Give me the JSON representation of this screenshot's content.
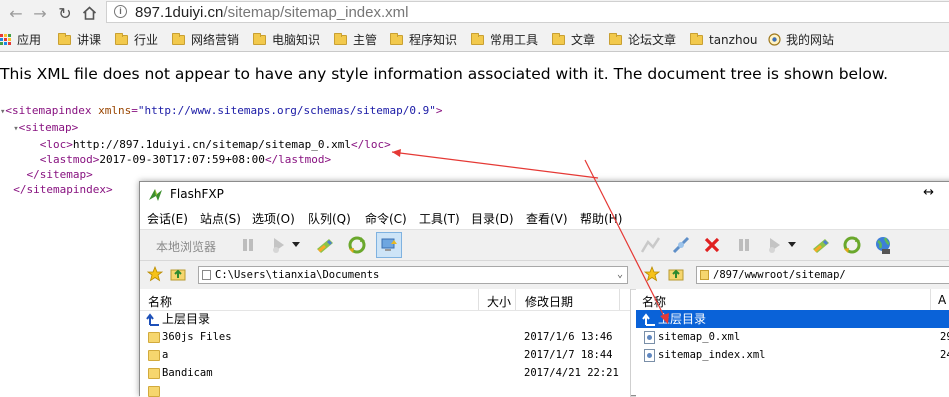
{
  "browser": {
    "url_host": "897.1duiyi.cn",
    "url_path": "/sitemap/sitemap_index.xml",
    "bookmarks": [
      {
        "label": "应用",
        "icon": "apps-icon"
      },
      {
        "label": "讲课",
        "icon": "folder-icon"
      },
      {
        "label": "行业",
        "icon": "folder-icon"
      },
      {
        "label": "网络营销",
        "icon": "folder-icon"
      },
      {
        "label": "电脑知识",
        "icon": "folder-icon"
      },
      {
        "label": "主管",
        "icon": "folder-icon"
      },
      {
        "label": "程序知识",
        "icon": "folder-icon"
      },
      {
        "label": "常用工具",
        "icon": "folder-icon"
      },
      {
        "label": "文章",
        "icon": "folder-icon"
      },
      {
        "label": "论坛文章",
        "icon": "folder-icon"
      },
      {
        "label": "tanzhou",
        "icon": "folder-icon"
      },
      {
        "label": "我的网站",
        "icon": "globe-icon"
      }
    ]
  },
  "xml": {
    "notice": "This XML file does not appear to have any style information associated with it. The document tree is shown below.",
    "root_open": "<sitemapindex",
    "root_attr_name": "xmlns",
    "root_attr_value": "\"http://www.sitemaps.org/schemas/sitemap/0.9\"",
    "sitemap_open": "<sitemap>",
    "loc_open": "<loc>",
    "loc_value": "http://897.1duiyi.cn/sitemap/sitemap_0.xml",
    "loc_close": "</loc>",
    "lastmod_open": "<lastmod>",
    "lastmod_value": "2017-09-30T17:07:59+08:00",
    "lastmod_close": "</lastmod>",
    "sitemap_close": "</sitemap>",
    "root_close": "</sitemapindex>"
  },
  "flashfxp": {
    "title": "FlashFXP",
    "menu": [
      "会话(E)",
      "站点(S)",
      "选项(O)",
      "队列(Q)",
      "命令(C)",
      "工具(T)",
      "目录(D)",
      "查看(V)",
      "帮助(H)"
    ],
    "local_browser_label": "本地浏览器",
    "local_path": "C:\\Users\\tianxia\\Documents",
    "remote_path": "/897/wwwroot/sitemap/",
    "local_columns": {
      "name": "名称",
      "size": "大小",
      "modified": "修改日期"
    },
    "remote_columns": {
      "name": "名称"
    },
    "parent_dir": "上层目录",
    "local_files": [
      {
        "name": "360js Files",
        "date": "2017/1/6 13:46"
      },
      {
        "name": "a",
        "date": "2017/1/7 18:44"
      },
      {
        "name": "Bandicam",
        "date": "2017/4/21 22:21"
      }
    ],
    "remote_files": [
      {
        "name": "sitemap_0.xml",
        "size_cut": "29"
      },
      {
        "name": "sitemap_index.xml",
        "size_cut": "24"
      }
    ],
    "remote_partial_column": "A"
  },
  "colors": {
    "annotation_arrow": "#e53935",
    "selection": "#0a62d8"
  }
}
